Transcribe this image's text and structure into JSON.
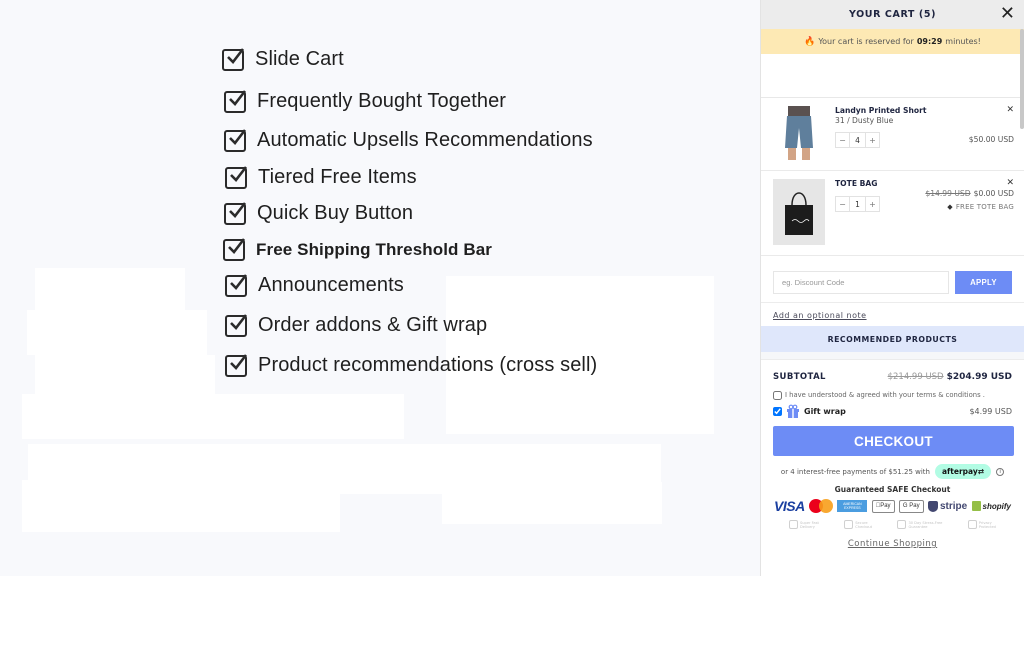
{
  "promo": {
    "features": [
      {
        "label": "Slide Cart",
        "checked": true
      },
      {
        "label": "Frequently Bought Together",
        "checked": true
      },
      {
        "label": "Automatic Upsells Recommendations",
        "checked": true
      },
      {
        "label": "Tiered Free Items",
        "checked": true
      },
      {
        "label": "Quick Buy Button",
        "checked": true
      },
      {
        "label": "Free Shipping Threshold Bar",
        "checked": true
      },
      {
        "label": "Announcements",
        "checked": true
      },
      {
        "label": "Order addons & Gift wrap",
        "checked": true
      },
      {
        "label": "Product recommendations (cross sell)",
        "checked": true
      }
    ]
  },
  "cart": {
    "title": "YOUR CART (5)",
    "close_icon": "close-icon",
    "reservation": {
      "prefix": "Your cart is reserved for",
      "time": "09:29",
      "suffix": "minutes!",
      "icon": "fire-icon"
    },
    "items": [
      {
        "title": "Landyn Printed Short",
        "variant": "31 / Dusty Blue",
        "quantity": "4",
        "price": "$50.00 USD",
        "image": "shorts-image"
      },
      {
        "title": "TOTE BAG",
        "quantity": "1",
        "compare_price": "$14.99 USD",
        "price": "$0.00 USD",
        "badge": "FREE TOTE BAG",
        "image": "tote-bag-image"
      }
    ],
    "discount": {
      "placeholder": "eg. Discount Code",
      "value": "",
      "apply_label": "APPLY"
    },
    "note_link": "Add an optional note",
    "recommended_label": "RECOMMENDED PRODUCTS",
    "summary": {
      "subtotal_label": "SUBTOTAL",
      "subtotal_compare": "$214.99 USD",
      "subtotal": "$204.99 USD",
      "terms_label": "I have understood & agreed with your terms & conditions .",
      "terms_checked": false,
      "gift_wrap_label": "Gift wrap",
      "gift_wrap_checked": true,
      "gift_wrap_price": "$4.99 USD",
      "checkout_label": "CHECKOUT",
      "afterpay_text": "or 4 interest-free payments of $51.25 with",
      "afterpay_brand": "afterpay",
      "afterpay_info": "i",
      "safe_checkout_title": "Guaranteed SAFE Checkout",
      "payment_logos": [
        "VISA",
        "MasterCard",
        "American Express",
        "Apple Pay",
        "G Pay",
        "stripe",
        "shopify"
      ],
      "trust_badges": [
        {
          "line1": "Super Fast",
          "line2": "Delivery"
        },
        {
          "line1": "Secure",
          "line2": "Checkout"
        },
        {
          "line1": "30 Day Stress-Free",
          "line2": "Guarantee"
        },
        {
          "line1": "Privacy",
          "line2": "Protected"
        }
      ],
      "continue_label": "Continue Shopping"
    },
    "colors": {
      "accent": "#6d8cf5",
      "reserve_bg": "#fde9b4",
      "recommended_bg": "#dfe7fb",
      "afterpay_bg": "#b2fce4"
    }
  }
}
